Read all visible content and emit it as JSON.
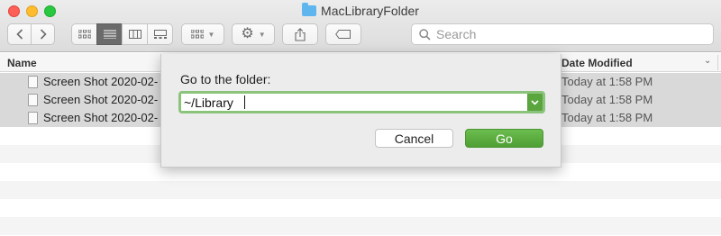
{
  "window": {
    "title": "MacLibraryFolder"
  },
  "toolbar": {
    "search_placeholder": "Search",
    "icons": [
      "chevron-left-icon",
      "chevron-right-icon",
      "icon-view-icon",
      "list-view-icon",
      "column-view-icon",
      "gallery-view-icon",
      "arrange-icon",
      "gear-icon",
      "share-icon",
      "tag-icon",
      "search-icon"
    ]
  },
  "list": {
    "columns": {
      "name": "Name",
      "date_modified": "Date Modified"
    },
    "rows": [
      {
        "name": "Screen Shot 2020-02-",
        "date": "Today at 1:58 PM"
      },
      {
        "name": "Screen Shot 2020-02-",
        "date": "Today at 1:58 PM"
      },
      {
        "name": "Screen Shot 2020-02-",
        "date": "Today at 1:58 PM"
      }
    ]
  },
  "dialog": {
    "label": "Go to the folder:",
    "path_value": "~/Library",
    "cancel_label": "Cancel",
    "go_label": "Go"
  },
  "colors": {
    "accent_green": "#5ba53f",
    "focus_ring": "#8cc37c",
    "selected_row": "#d9d9d9"
  }
}
